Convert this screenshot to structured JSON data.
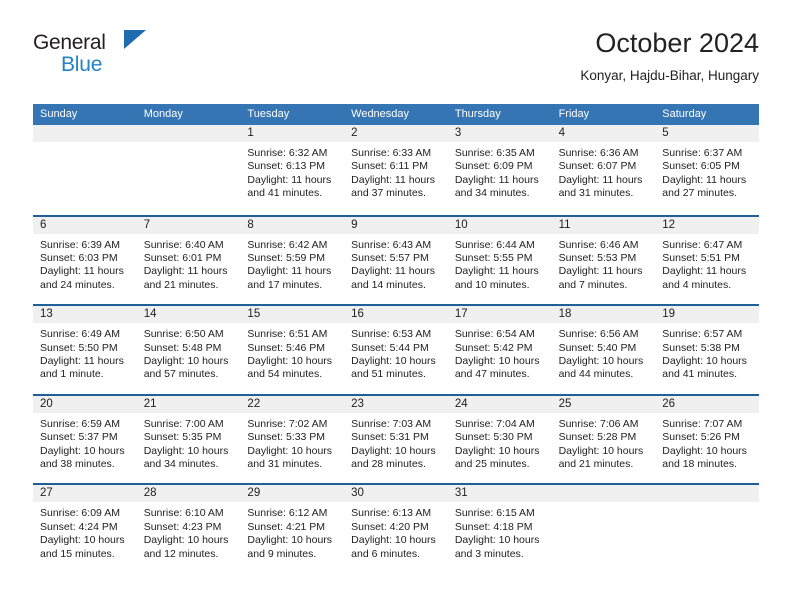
{
  "brand": {
    "name_top": "General",
    "name_bottom": "Blue",
    "triangle_color": "#1e6bb0",
    "bottom_color": "#2483c5"
  },
  "header": {
    "title": "October 2024",
    "subtitle": "Konyar, Hajdu-Bihar, Hungary"
  },
  "colors": {
    "header_row_bg": "#3575b4",
    "week_separator": "#1f6099",
    "daynum_bg": "#f0f0f0",
    "text": "#222222"
  },
  "weekdays": [
    "Sunday",
    "Monday",
    "Tuesday",
    "Wednesday",
    "Thursday",
    "Friday",
    "Saturday"
  ],
  "weeks": [
    [
      {
        "day": "",
        "empty": true
      },
      {
        "day": "",
        "empty": true
      },
      {
        "day": "1",
        "sunrise": "Sunrise: 6:32 AM",
        "sunset": "Sunset: 6:13 PM",
        "daylight": "Daylight: 11 hours and 41 minutes."
      },
      {
        "day": "2",
        "sunrise": "Sunrise: 6:33 AM",
        "sunset": "Sunset: 6:11 PM",
        "daylight": "Daylight: 11 hours and 37 minutes."
      },
      {
        "day": "3",
        "sunrise": "Sunrise: 6:35 AM",
        "sunset": "Sunset: 6:09 PM",
        "daylight": "Daylight: 11 hours and 34 minutes."
      },
      {
        "day": "4",
        "sunrise": "Sunrise: 6:36 AM",
        "sunset": "Sunset: 6:07 PM",
        "daylight": "Daylight: 11 hours and 31 minutes."
      },
      {
        "day": "5",
        "sunrise": "Sunrise: 6:37 AM",
        "sunset": "Sunset: 6:05 PM",
        "daylight": "Daylight: 11 hours and 27 minutes."
      }
    ],
    [
      {
        "day": "6",
        "sunrise": "Sunrise: 6:39 AM",
        "sunset": "Sunset: 6:03 PM",
        "daylight": "Daylight: 11 hours and 24 minutes."
      },
      {
        "day": "7",
        "sunrise": "Sunrise: 6:40 AM",
        "sunset": "Sunset: 6:01 PM",
        "daylight": "Daylight: 11 hours and 21 minutes."
      },
      {
        "day": "8",
        "sunrise": "Sunrise: 6:42 AM",
        "sunset": "Sunset: 5:59 PM",
        "daylight": "Daylight: 11 hours and 17 minutes."
      },
      {
        "day": "9",
        "sunrise": "Sunrise: 6:43 AM",
        "sunset": "Sunset: 5:57 PM",
        "daylight": "Daylight: 11 hours and 14 minutes."
      },
      {
        "day": "10",
        "sunrise": "Sunrise: 6:44 AM",
        "sunset": "Sunset: 5:55 PM",
        "daylight": "Daylight: 11 hours and 10 minutes."
      },
      {
        "day": "11",
        "sunrise": "Sunrise: 6:46 AM",
        "sunset": "Sunset: 5:53 PM",
        "daylight": "Daylight: 11 hours and 7 minutes."
      },
      {
        "day": "12",
        "sunrise": "Sunrise: 6:47 AM",
        "sunset": "Sunset: 5:51 PM",
        "daylight": "Daylight: 11 hours and 4 minutes."
      }
    ],
    [
      {
        "day": "13",
        "sunrise": "Sunrise: 6:49 AM",
        "sunset": "Sunset: 5:50 PM",
        "daylight": "Daylight: 11 hours and 1 minute."
      },
      {
        "day": "14",
        "sunrise": "Sunrise: 6:50 AM",
        "sunset": "Sunset: 5:48 PM",
        "daylight": "Daylight: 10 hours and 57 minutes."
      },
      {
        "day": "15",
        "sunrise": "Sunrise: 6:51 AM",
        "sunset": "Sunset: 5:46 PM",
        "daylight": "Daylight: 10 hours and 54 minutes."
      },
      {
        "day": "16",
        "sunrise": "Sunrise: 6:53 AM",
        "sunset": "Sunset: 5:44 PM",
        "daylight": "Daylight: 10 hours and 51 minutes."
      },
      {
        "day": "17",
        "sunrise": "Sunrise: 6:54 AM",
        "sunset": "Sunset: 5:42 PM",
        "daylight": "Daylight: 10 hours and 47 minutes."
      },
      {
        "day": "18",
        "sunrise": "Sunrise: 6:56 AM",
        "sunset": "Sunset: 5:40 PM",
        "daylight": "Daylight: 10 hours and 44 minutes."
      },
      {
        "day": "19",
        "sunrise": "Sunrise: 6:57 AM",
        "sunset": "Sunset: 5:38 PM",
        "daylight": "Daylight: 10 hours and 41 minutes."
      }
    ],
    [
      {
        "day": "20",
        "sunrise": "Sunrise: 6:59 AM",
        "sunset": "Sunset: 5:37 PM",
        "daylight": "Daylight: 10 hours and 38 minutes."
      },
      {
        "day": "21",
        "sunrise": "Sunrise: 7:00 AM",
        "sunset": "Sunset: 5:35 PM",
        "daylight": "Daylight: 10 hours and 34 minutes."
      },
      {
        "day": "22",
        "sunrise": "Sunrise: 7:02 AM",
        "sunset": "Sunset: 5:33 PM",
        "daylight": "Daylight: 10 hours and 31 minutes."
      },
      {
        "day": "23",
        "sunrise": "Sunrise: 7:03 AM",
        "sunset": "Sunset: 5:31 PM",
        "daylight": "Daylight: 10 hours and 28 minutes."
      },
      {
        "day": "24",
        "sunrise": "Sunrise: 7:04 AM",
        "sunset": "Sunset: 5:30 PM",
        "daylight": "Daylight: 10 hours and 25 minutes."
      },
      {
        "day": "25",
        "sunrise": "Sunrise: 7:06 AM",
        "sunset": "Sunset: 5:28 PM",
        "daylight": "Daylight: 10 hours and 21 minutes."
      },
      {
        "day": "26",
        "sunrise": "Sunrise: 7:07 AM",
        "sunset": "Sunset: 5:26 PM",
        "daylight": "Daylight: 10 hours and 18 minutes."
      }
    ],
    [
      {
        "day": "27",
        "sunrise": "Sunrise: 6:09 AM",
        "sunset": "Sunset: 4:24 PM",
        "daylight": "Daylight: 10 hours and 15 minutes."
      },
      {
        "day": "28",
        "sunrise": "Sunrise: 6:10 AM",
        "sunset": "Sunset: 4:23 PM",
        "daylight": "Daylight: 10 hours and 12 minutes."
      },
      {
        "day": "29",
        "sunrise": "Sunrise: 6:12 AM",
        "sunset": "Sunset: 4:21 PM",
        "daylight": "Daylight: 10 hours and 9 minutes."
      },
      {
        "day": "30",
        "sunrise": "Sunrise: 6:13 AM",
        "sunset": "Sunset: 4:20 PM",
        "daylight": "Daylight: 10 hours and 6 minutes."
      },
      {
        "day": "31",
        "sunrise": "Sunrise: 6:15 AM",
        "sunset": "Sunset: 4:18 PM",
        "daylight": "Daylight: 10 hours and 3 minutes."
      },
      {
        "day": "",
        "empty": true
      },
      {
        "day": "",
        "empty": true
      }
    ]
  ]
}
